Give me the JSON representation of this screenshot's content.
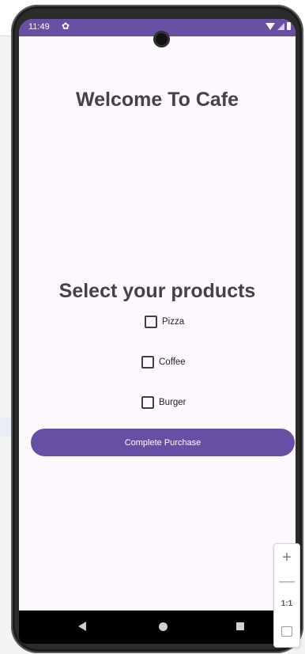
{
  "status_bar": {
    "time": "11:49"
  },
  "main": {
    "welcome_title": "Welcome To Cafe",
    "products_title": "Select your products",
    "products": [
      {
        "label": "Pizza",
        "checked": false
      },
      {
        "label": "Coffee",
        "checked": false
      },
      {
        "label": "Burger",
        "checked": false
      }
    ],
    "purchase_button": "Complete Purchase"
  },
  "zoom_controls": {
    "zoom_in": "+",
    "zoom_out": "—",
    "actual_size": "1:1"
  },
  "icons": {
    "settings": "gear-icon",
    "wifi": "wifi-icon",
    "signal": "signal-icon",
    "battery": "battery-icon",
    "back": "back-icon",
    "home": "home-icon",
    "recents": "recents-icon",
    "fit": "fit-screen-icon"
  },
  "colors": {
    "primary": "#6750a4",
    "screen_background": "#fdf7fe",
    "title_text": "#454147"
  }
}
